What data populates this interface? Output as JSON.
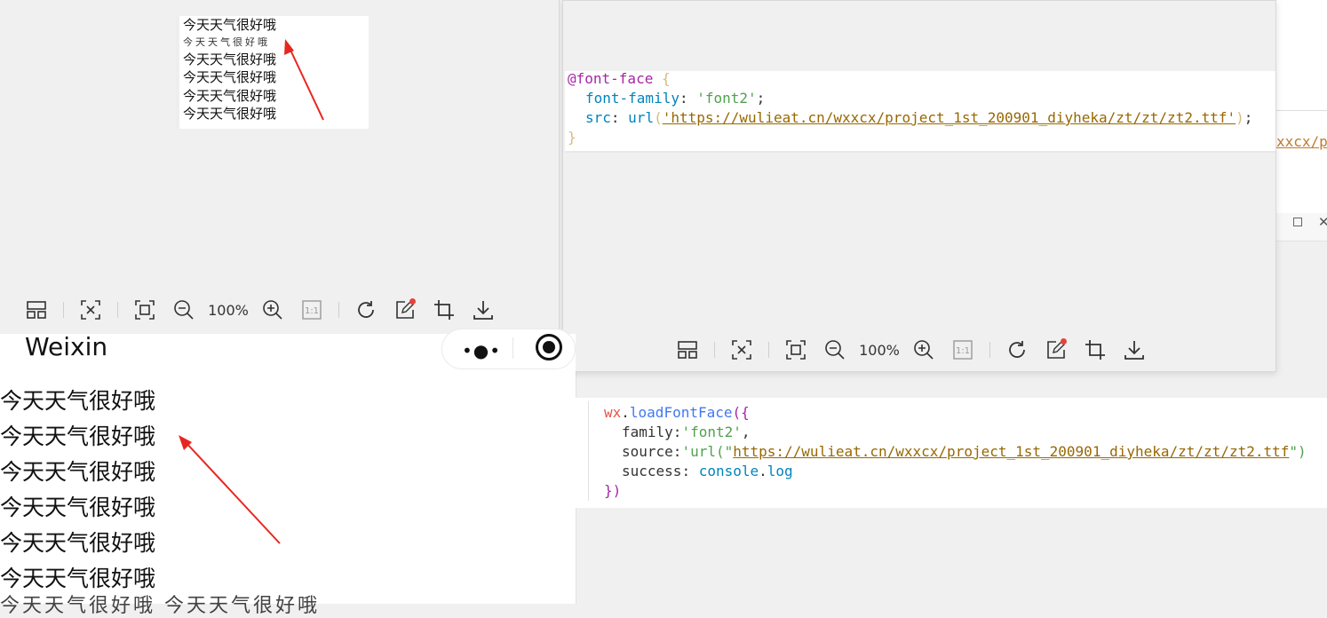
{
  "viewer_left": {
    "image_lines": [
      "今天天气很好哦",
      "今天天气很好哦",
      "今天天气很好哦",
      "今天天气很好哦",
      "今天天气很好哦"
    ],
    "image_fuzzy_line": "今天天气很好哦",
    "zoom": "100%",
    "icons": [
      "layout-icon",
      "fit-screen-icon",
      "fullscreen-icon",
      "zoom-out-icon",
      "zoom-in-icon",
      "actual-size-icon",
      "rotate-icon",
      "edit-icon",
      "crop-icon",
      "download-icon"
    ]
  },
  "viewer_right": {
    "zoom": "100%",
    "actual_size_label": "1:1"
  },
  "code_css": {
    "line1_at": "@font-face",
    "line1_brace": "{",
    "line2_prop": "font-family",
    "line2_val": "'font2'",
    "line3_prop": "src",
    "line3_fn": "url",
    "line3_url": "'https://wulieat.cn/wxxcx/project_1st_200901_diyheka/zt/zt/zt2.ttf'",
    "line4_brace": "}"
  },
  "code_js": {
    "obj": "wx",
    "method": "loadFontFace",
    "family_key": "family",
    "family_val": "'font2'",
    "source_key": "source",
    "source_prefix": "'url(\"",
    "source_url": "https://wulieat.cn/wxxcx/project_1st_200901_diyheka/zt/zt/zt2.ttf",
    "source_suffix": "\")",
    "success_key": "success",
    "success_val_obj": "console",
    "success_val_fn": "log",
    "close": "})"
  },
  "phone": {
    "title": "Weixin",
    "lines": [
      "今天天气很好哦",
      "今天天气很好哦",
      "今天天气很好哦",
      "今天天气很好哦",
      "今天天气很好哦",
      "今天天气很好哦"
    ],
    "cut_line": "今天天气很好哦 今天天气很好哦"
  },
  "background": {
    "fragment_text": "xxcx/pr"
  },
  "colors": {
    "arrow": "#e8261f",
    "code_purple": "#a626a4",
    "code_blue": "#4078f2",
    "code_teal": "#0184bc",
    "code_orange": "#c18401",
    "code_green": "#50a14f",
    "code_url": "#986801"
  }
}
